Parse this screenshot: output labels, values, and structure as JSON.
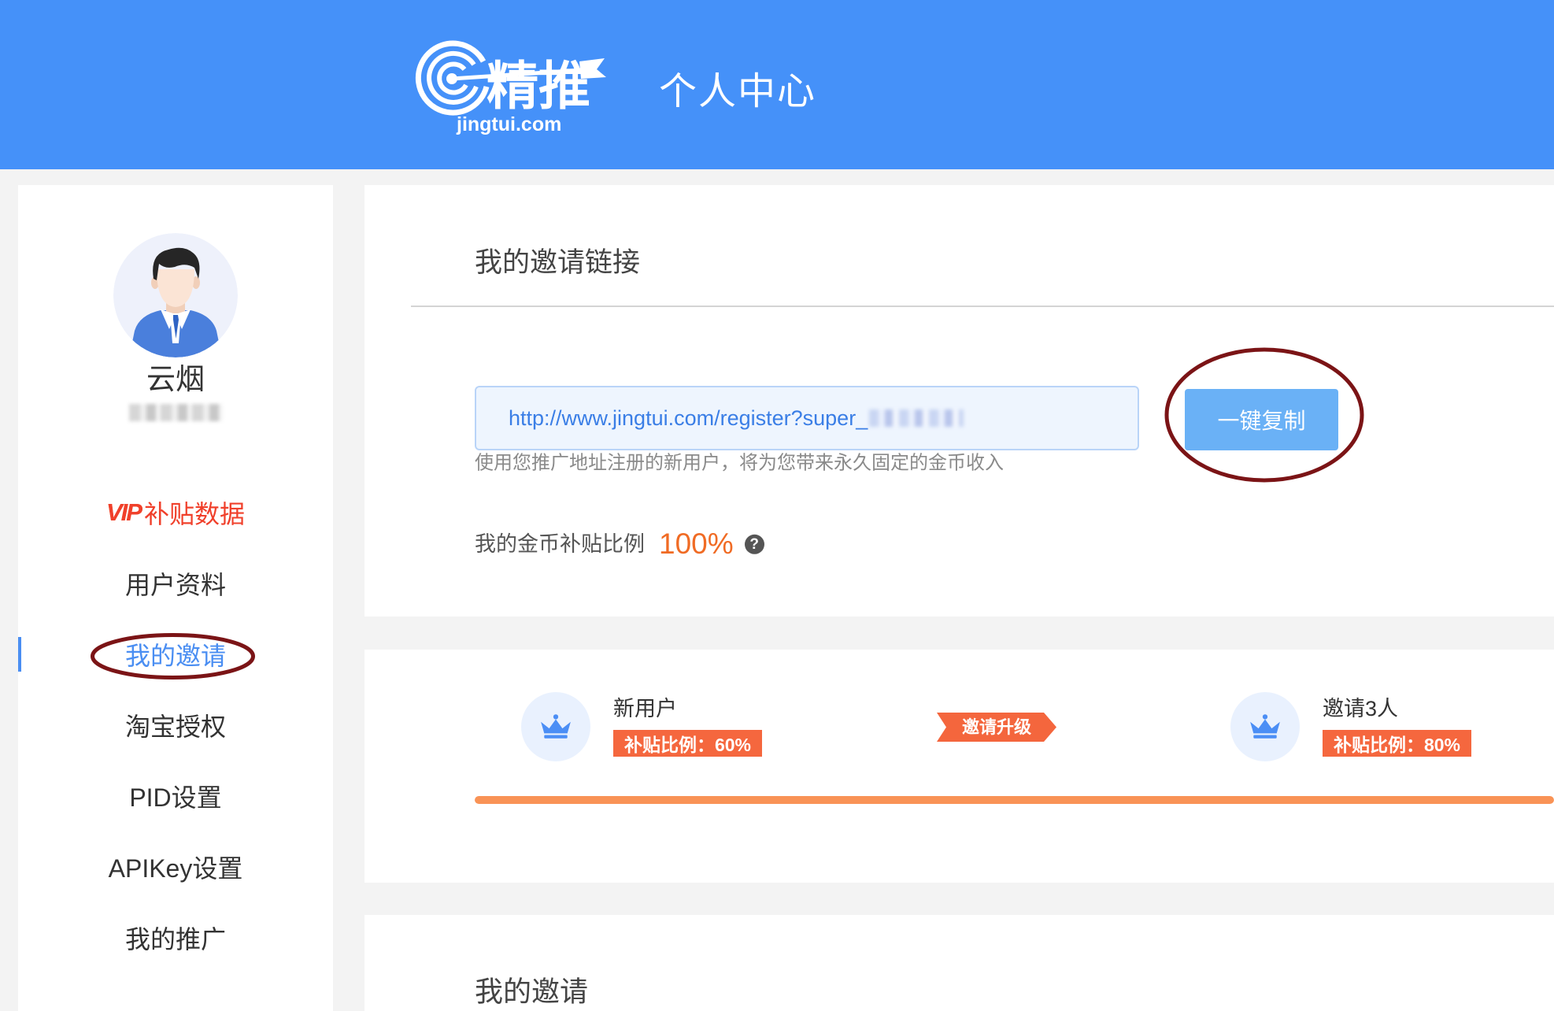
{
  "header": {
    "logo_text": "精推",
    "logo_domain": "jingtui.com",
    "title": "个人中心"
  },
  "sidebar": {
    "user_name": "云烟",
    "menu": [
      {
        "badge": "VIP",
        "label": "补贴数据"
      },
      {
        "label": "用户资料"
      },
      {
        "label": "我的邀请",
        "active": true
      },
      {
        "label": "淘宝授权"
      },
      {
        "label": "PID设置"
      },
      {
        "label": "APIKey设置"
      },
      {
        "label": "我的推广"
      }
    ]
  },
  "invite_link": {
    "title": "我的邀请链接",
    "url": "http://www.jingtui.com/register?super_",
    "copy_button": "一键复制",
    "hint": "使用您推广地址注册的新用户，将为您带来永久固定的金币收入",
    "ratio_label": "我的金币补贴比例",
    "ratio_value": "100%"
  },
  "levels": {
    "items": [
      {
        "title": "新用户",
        "badge": "补贴比例：60%"
      },
      {
        "title": "邀请3人",
        "badge": "补贴比例：80%"
      }
    ],
    "upgrade_label": "邀请升级",
    "progress_fraction": 1
  },
  "my_invites": {
    "title": "我的邀请"
  },
  "icons": {
    "logo": "jingtui-target-arrow-logo",
    "avatar": "user-avatar",
    "help": "question-circle-icon",
    "level": "crown-icon",
    "upgrade": "arrow-right-tag"
  },
  "colors": {
    "header_bg": "#4591f9",
    "accent": "#4a8ef2",
    "orange": "#f06b24",
    "badge_bg": "#f5673e",
    "progress": "#f99356",
    "annotation": "#7b1416",
    "button_bg": "#6ab1f6",
    "vip": "#f0402b"
  }
}
